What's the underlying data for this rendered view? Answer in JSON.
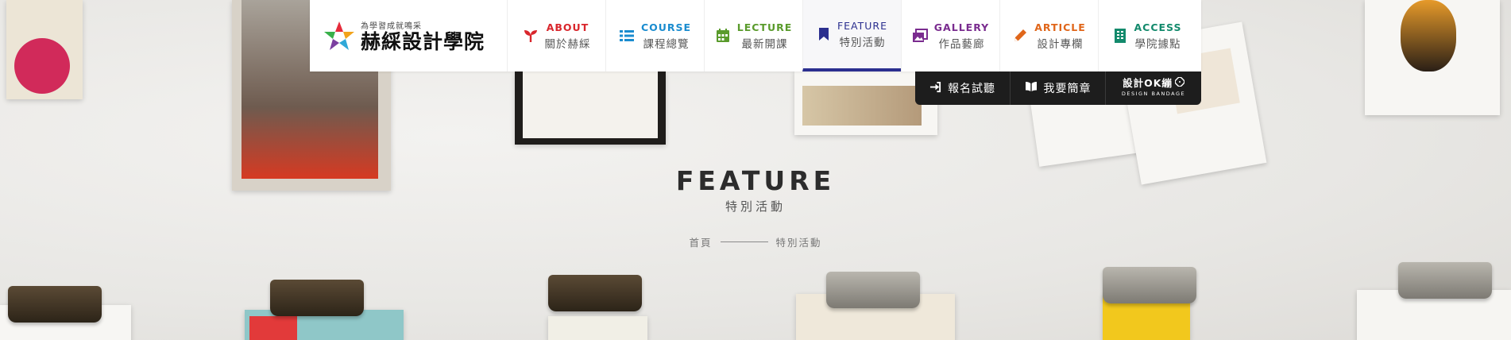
{
  "brand": {
    "tagline": "為學習成就鳴采",
    "name": "赫綵設計學院"
  },
  "nav": {
    "items": [
      {
        "en": "ABOUT",
        "zh": "關於赫綵",
        "color": "#d9262c",
        "icon": "sprout-icon"
      },
      {
        "en": "COURSE",
        "zh": "課程總覽",
        "color": "#1a8ccf",
        "icon": "list-icon"
      },
      {
        "en": "LECTURE",
        "zh": "最新開課",
        "color": "#5a9b2c",
        "icon": "calendar-icon"
      },
      {
        "en": "FEATURE",
        "zh": "特別活動",
        "color": "#2b2f8f",
        "icon": "bookmark-icon"
      },
      {
        "en": "GALLERY",
        "zh": "作品藝廊",
        "color": "#7a2c8f",
        "icon": "images-icon"
      },
      {
        "en": "ARTICLE",
        "zh": "設計專欄",
        "color": "#e0661a",
        "icon": "pencil-icon"
      },
      {
        "en": "ACCESS",
        "zh": "學院據點",
        "color": "#138a6c",
        "icon": "building-icon"
      }
    ]
  },
  "actions": {
    "signup": "報名試聽",
    "brochure": "我要簡章",
    "ok_main": "設計OK繃",
    "ok_sub": "DESIGN BANDAGE"
  },
  "page": {
    "title": "FEATURE",
    "subtitle": "特別活動"
  },
  "breadcrumb": {
    "home": "首頁",
    "current": "特別活動"
  }
}
